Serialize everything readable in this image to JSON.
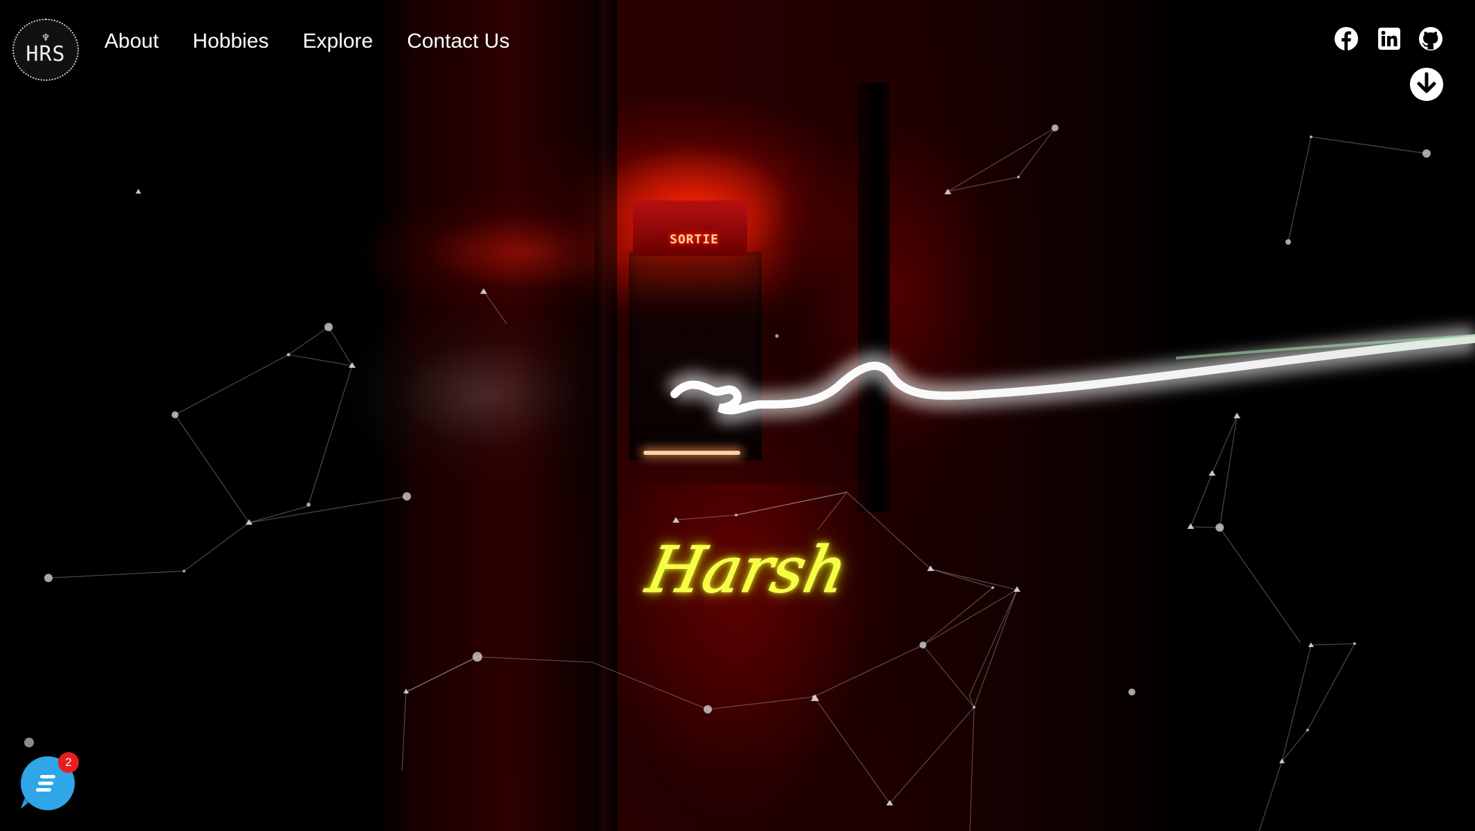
{
  "logo": {
    "text": "HRS",
    "emblem": "♆"
  },
  "nav": {
    "items": [
      "About",
      "Hobbies",
      "Explore",
      "Contact Us"
    ]
  },
  "social": {
    "icons": [
      "facebook-icon",
      "linkedin-icon",
      "github-icon"
    ]
  },
  "scroll": {
    "icon": "arrow-down-circle-icon"
  },
  "hero": {
    "name": "Harsh",
    "sign_text": "SORTIE"
  },
  "chat": {
    "icon": "chat-bubble-icon",
    "badge_count": "2"
  },
  "colors": {
    "background": "#000000",
    "accent_red": "#ff2a0a",
    "name_yellow": "#f6ff3a",
    "chat_blue": "#2ea6e8",
    "badge_red": "#e81e1e",
    "nav_text": "#ffffff"
  }
}
